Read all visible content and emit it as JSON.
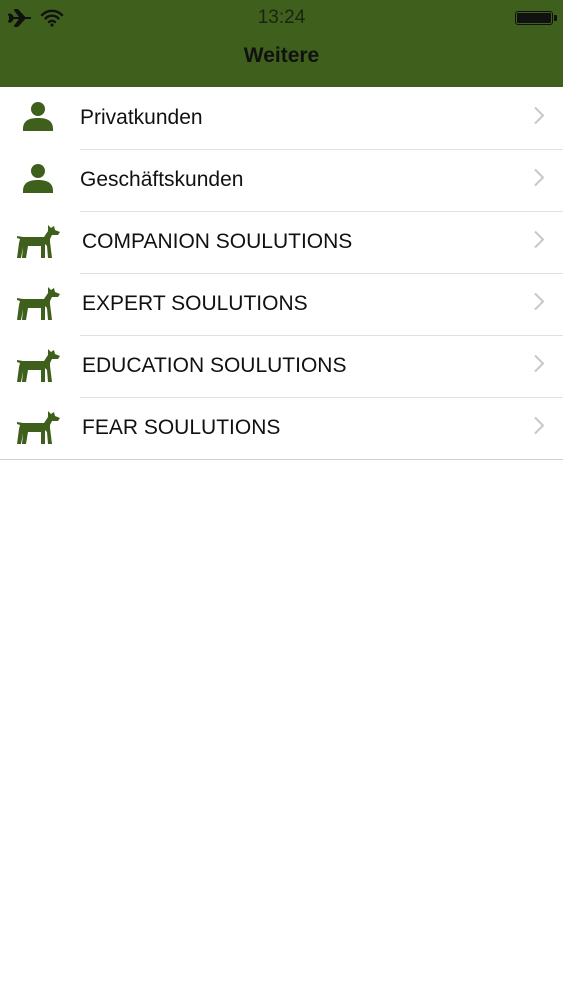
{
  "status_bar": {
    "time": "13:24",
    "icons": [
      "airplane-icon",
      "wifi-icon",
      "battery-icon"
    ]
  },
  "nav": {
    "title": "Weitere"
  },
  "colors": {
    "nav_background": "#3f5f1c",
    "icon_green": "#3f5f1c",
    "chevron": "#c7c7cc",
    "separator": "#e0e0e0"
  },
  "menu": {
    "items": [
      {
        "label": "Privatkunden",
        "icon": "person-icon"
      },
      {
        "label": "Geschäftskunden",
        "icon": "person-icon"
      },
      {
        "label": "COMPANION SOULUTIONS",
        "icon": "dog-icon"
      },
      {
        "label": "EXPERT SOULUTIONS",
        "icon": "dog-icon"
      },
      {
        "label": "EDUCATION SOULUTIONS",
        "icon": "dog-icon"
      },
      {
        "label": "FEAR SOULUTIONS",
        "icon": "dog-icon"
      }
    ]
  }
}
